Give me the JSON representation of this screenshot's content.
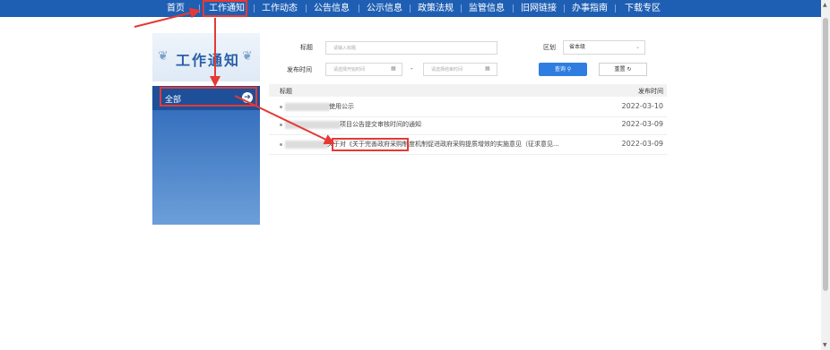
{
  "nav": {
    "items": [
      "首页",
      "工作通知",
      "工作动态",
      "公告信息",
      "公示信息",
      "政策法规",
      "监管信息",
      "旧网链接",
      "办事指南",
      "下载专区"
    ]
  },
  "sidebar": {
    "title": "工作通知",
    "items": [
      {
        "label": "全部"
      }
    ]
  },
  "search": {
    "title_label": "标题",
    "title_placeholder": "请输入标题",
    "date_label": "发布时间",
    "start_placeholder": "请选择开始时间",
    "range_sep": "-",
    "end_placeholder": "请选择结束时间",
    "region_label": "区划",
    "region_value": "省本级",
    "query_label": "查询",
    "reset_label": "重置"
  },
  "table": {
    "headers": {
      "title": "标题",
      "date": "发布时间"
    },
    "rows": [
      {
        "title": "使用公示",
        "date": "2022-03-10"
      },
      {
        "title": "项目公告提交审核时间的通知",
        "date": "2022-03-09"
      },
      {
        "title": "关于对《关于完善政府采购制度机制促进政府采购提质增效的实施意见（征求意见...",
        "date": "2022-03-09"
      }
    ]
  },
  "colors": {
    "nav_bg": "#1f5fb3",
    "accent": "#2f7de1",
    "highlight": "#e53935"
  }
}
